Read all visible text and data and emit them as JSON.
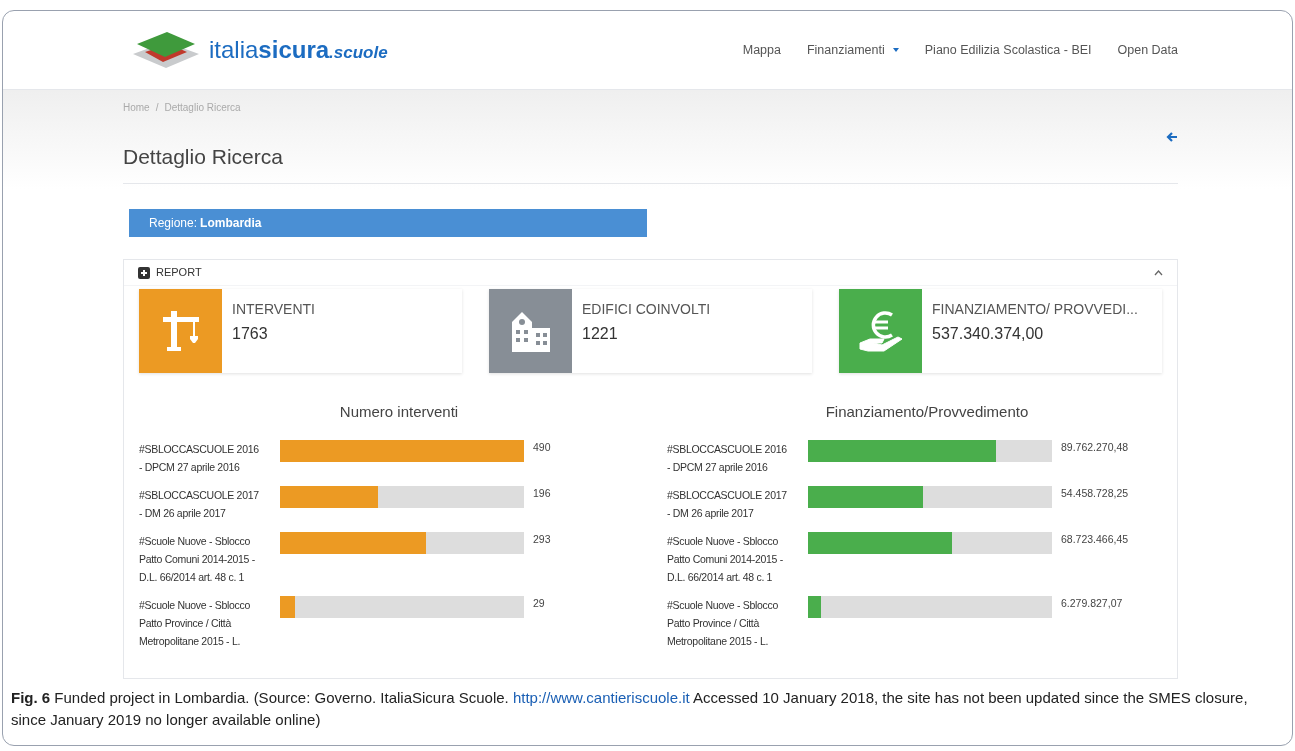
{
  "header": {
    "logo": {
      "light": "italia",
      "bold": "sicura",
      "suffix": ".scuole"
    },
    "nav": [
      {
        "label": "Mappa",
        "dropdown": false
      },
      {
        "label": "Finanziamenti",
        "dropdown": true
      },
      {
        "label": "Piano Edilizia Scolastica - BEI",
        "dropdown": false
      },
      {
        "label": "Open Data",
        "dropdown": false
      }
    ]
  },
  "breadcrumb": {
    "items": [
      "Home",
      "Dettaglio Ricerca"
    ],
    "separator": "/"
  },
  "page_title": "Dettaglio Ricerca",
  "region": {
    "label": "Regione:",
    "value": "Lombardia"
  },
  "report": {
    "title": "REPORT",
    "expanded": true,
    "stats": [
      {
        "kind": "crane",
        "label": "INTERVENTI",
        "value": "1763",
        "color": "#ec9a23"
      },
      {
        "kind": "building",
        "label": "EDIFICI COINVOLTI",
        "value": "1221",
        "color": "#878e96"
      },
      {
        "kind": "money",
        "label": "FINANZIAMENTO/ PROVVEDI...",
        "value": "537.340.374,00",
        "color": "#4aae4c"
      }
    ],
    "charts": [
      {
        "title": "Numero interventi",
        "color": "#ec9a23",
        "rows": [
          {
            "label": "#SBLOCCASCUOLE 2016 - DPCM 27 aprile 2016",
            "level": 1,
            "reading": "490"
          },
          {
            "label": "#SBLOCCASCUOLE 2017 - DM 26 aprile 2017",
            "level": 0.4,
            "reading": "196"
          },
          {
            "label": "#Scuole Nuove - Sblocco Patto Comuni 2014-2015 - D.L. 66/2014 art. 48 c. 1",
            "level": 0.6,
            "reading": "293"
          },
          {
            "label": "#Scuole Nuove - Sblocco Patto Province / Città Metropolitane 2015 - L.",
            "level": 0.06,
            "reading": "29"
          }
        ]
      },
      {
        "title": "Finanziamento/Provvedimento",
        "color": "#4aae4c",
        "rows": [
          {
            "label": "#SBLOCCASCUOLE 2016 - DPCM 27 aprile 2016",
            "level": 0.77,
            "reading": "89.762.270,48"
          },
          {
            "label": "#SBLOCCASCUOLE 2017 - DM 26 aprile 2017",
            "level": 0.47,
            "reading": "54.458.728,25"
          },
          {
            "label": "#Scuole Nuove - Sblocco Patto Comuni 2014-2015 - D.L. 66/2014 art. 48 c. 1",
            "level": 0.59,
            "reading": "68.723.466,45"
          },
          {
            "label": "#Scuole Nuove - Sblocco Patto Province / Città Metropolitane 2015 - L.",
            "level": 0.055,
            "reading": "6.279.827,07"
          }
        ]
      }
    ]
  },
  "caption": {
    "label": "Fig. 6",
    "text": "Funded project in Lombardia. (Source: Governo. ItaliaSicura Scuole.",
    "link": "http://www.cantieriscuole.it",
    "text_after": "Accessed 10 January 2018, the site has not been updated since the SMES closure, since January 2019 no longer available online)"
  }
}
